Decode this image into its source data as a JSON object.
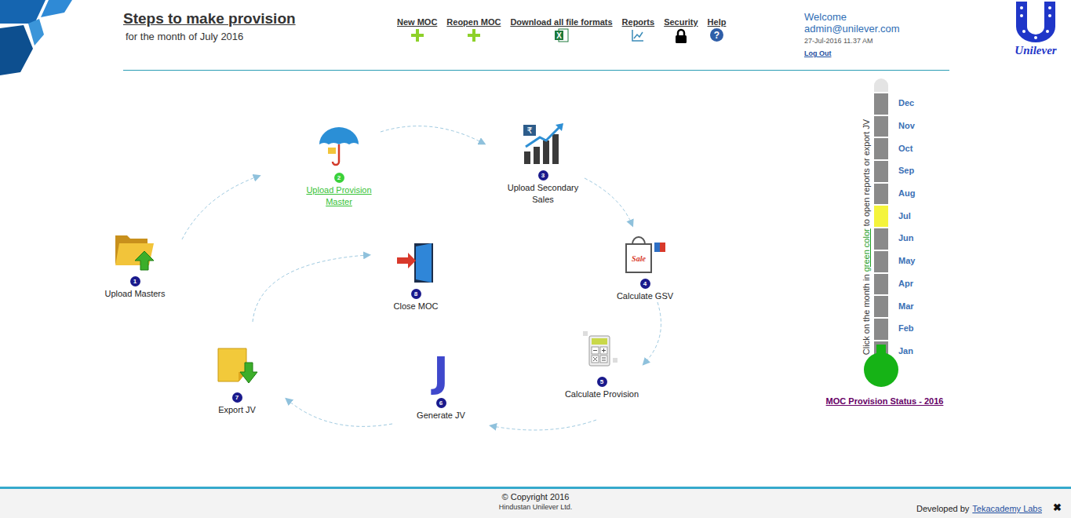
{
  "header": {
    "title": "Steps to make provision",
    "subtitle": "for the month of July 2016"
  },
  "nav": [
    {
      "label": "New MOC",
      "kind": "plus"
    },
    {
      "label": "Reopen MOC",
      "kind": "plus"
    },
    {
      "label": "Download all file formats",
      "kind": "excel",
      "glyph": "X"
    },
    {
      "label": "Reports",
      "kind": "chart"
    },
    {
      "label": "Security",
      "kind": "lock"
    },
    {
      "label": "Help",
      "kind": "help",
      "glyph": "?"
    }
  ],
  "user": {
    "greeting": "Welcome",
    "email": "admin@unilever.com",
    "datetime": "27-Jul-2016 11.37 AM",
    "logout": "Log Out"
  },
  "logo": {
    "text": "Unilever"
  },
  "steps": [
    {
      "number": "1",
      "label": "Upload Masters",
      "active": false,
      "kind": "folder"
    },
    {
      "number": "2",
      "label": "Upload Provision Master",
      "active": true,
      "kind": "umbrella"
    },
    {
      "number": "3",
      "label": "Upload Secondary Sales",
      "active": false,
      "kind": "sales",
      "glyph": "₹"
    },
    {
      "number": "4",
      "label": "Calculate GSV",
      "active": false,
      "kind": "bag",
      "glyph": "Sale"
    },
    {
      "number": "5",
      "label": "Calculate Provision",
      "active": false,
      "kind": "calculator"
    },
    {
      "number": "6",
      "label": "Generate JV",
      "active": false,
      "kind": "letter",
      "glyph": "J"
    },
    {
      "number": "7",
      "label": "Export JV",
      "active": false,
      "kind": "export"
    },
    {
      "number": "8",
      "label": "Close MOC",
      "active": false,
      "kind": "door"
    }
  ],
  "status": {
    "hint_start": "Click on the month in ",
    "hint_link": "green color",
    "hint_end": " to open reports or export JV",
    "months": [
      {
        "name": "Dec",
        "color": "#8a8a8a"
      },
      {
        "name": "Nov",
        "color": "#8a8a8a"
      },
      {
        "name": "Oct",
        "color": "#8a8a8a"
      },
      {
        "name": "Sep",
        "color": "#8a8a8a"
      },
      {
        "name": "Aug",
        "color": "#8a8a8a"
      },
      {
        "name": "Jul",
        "color": "#f4f43c"
      },
      {
        "name": "Jun",
        "color": "#8a8a8a"
      },
      {
        "name": "May",
        "color": "#8a8a8a"
      },
      {
        "name": "Apr",
        "color": "#8a8a8a"
      },
      {
        "name": "Mar",
        "color": "#8a8a8a"
      },
      {
        "name": "Feb",
        "color": "#8a8a8a"
      },
      {
        "name": "Jan",
        "color": "#8a8a8a"
      }
    ],
    "title": "MOC Provision Status - 2016"
  },
  "footer": {
    "copyright_glyph": "©",
    "copyright": "Copyright 2016",
    "company": "Hindustan Unilever Ltd.",
    "developed_by": "Developed by",
    "developer": "Tekacademy Labs",
    "close": "✖"
  }
}
